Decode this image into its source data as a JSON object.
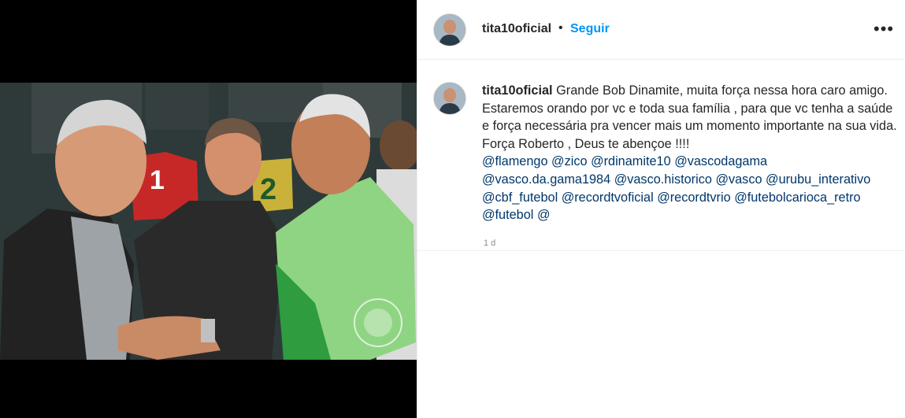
{
  "post": {
    "username": "tita10oficial",
    "separator": "•",
    "follow_label": "Seguir",
    "more_icon": "more-horizontal-icon",
    "caption_username": "tita10oficial",
    "caption_text": "Grande Bob Dinamite, muita força nessa hora caro amigo. Estaremos orando por vc e toda sua família , para que vc tenha a saúde e força necessária pra vencer mais um momento importante na sua vida. Força Roberto , Deus te abençoe !!!!",
    "mentions": [
      "@flamengo",
      "@zico",
      "@rdinamite10",
      "@vascodagama",
      "@vasco.da.gama1984",
      "@vasco.historico",
      "@vasco",
      "@urubu_interativo",
      "@cbf_futebol",
      "@recordtvoficial",
      "@recordtvrio",
      "@futebolcarioca_retro",
      "@futebol",
      "@"
    ],
    "timestamp": "1 d"
  }
}
